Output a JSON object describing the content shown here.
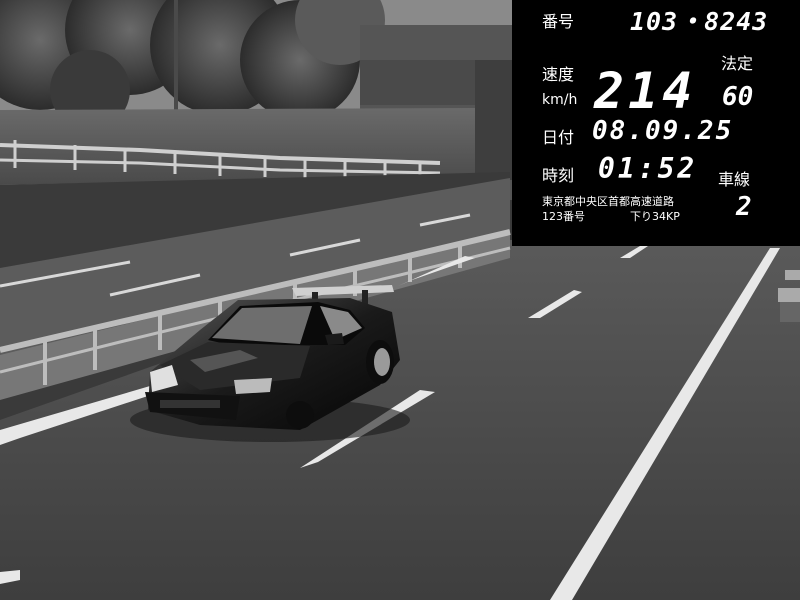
{
  "hud": {
    "plate_label": "番号",
    "plate_value": "103・8243",
    "speed_label": "速度",
    "speed_unit": "km/h",
    "speed_value": "214",
    "limit_label": "法定",
    "limit_value": "60",
    "date_label": "日付",
    "date_value": "08.09.25",
    "time_label": "時刻",
    "time_value": "01:52",
    "lane_label": "車線",
    "lane_value": "2",
    "location_line1": "東京都中央区首都高速道路",
    "location_line2": "123番号",
    "direction": "下り34KP"
  },
  "colors": {
    "hud_background": "#000000",
    "hud_text": "#ffffff"
  }
}
